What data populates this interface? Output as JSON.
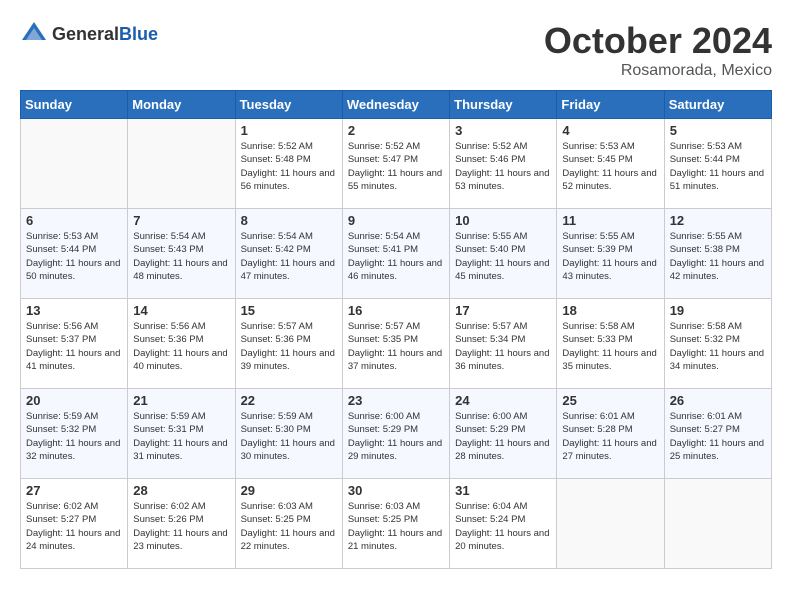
{
  "logo": {
    "general": "General",
    "blue": "Blue"
  },
  "title": {
    "month": "October 2024",
    "location": "Rosamorada, Mexico"
  },
  "headers": [
    "Sunday",
    "Monday",
    "Tuesday",
    "Wednesday",
    "Thursday",
    "Friday",
    "Saturday"
  ],
  "weeks": [
    [
      {
        "day": "",
        "info": ""
      },
      {
        "day": "",
        "info": ""
      },
      {
        "day": "1",
        "info": "Sunrise: 5:52 AM\nSunset: 5:48 PM\nDaylight: 11 hours and 56 minutes."
      },
      {
        "day": "2",
        "info": "Sunrise: 5:52 AM\nSunset: 5:47 PM\nDaylight: 11 hours and 55 minutes."
      },
      {
        "day": "3",
        "info": "Sunrise: 5:52 AM\nSunset: 5:46 PM\nDaylight: 11 hours and 53 minutes."
      },
      {
        "day": "4",
        "info": "Sunrise: 5:53 AM\nSunset: 5:45 PM\nDaylight: 11 hours and 52 minutes."
      },
      {
        "day": "5",
        "info": "Sunrise: 5:53 AM\nSunset: 5:44 PM\nDaylight: 11 hours and 51 minutes."
      }
    ],
    [
      {
        "day": "6",
        "info": "Sunrise: 5:53 AM\nSunset: 5:44 PM\nDaylight: 11 hours and 50 minutes."
      },
      {
        "day": "7",
        "info": "Sunrise: 5:54 AM\nSunset: 5:43 PM\nDaylight: 11 hours and 48 minutes."
      },
      {
        "day": "8",
        "info": "Sunrise: 5:54 AM\nSunset: 5:42 PM\nDaylight: 11 hours and 47 minutes."
      },
      {
        "day": "9",
        "info": "Sunrise: 5:54 AM\nSunset: 5:41 PM\nDaylight: 11 hours and 46 minutes."
      },
      {
        "day": "10",
        "info": "Sunrise: 5:55 AM\nSunset: 5:40 PM\nDaylight: 11 hours and 45 minutes."
      },
      {
        "day": "11",
        "info": "Sunrise: 5:55 AM\nSunset: 5:39 PM\nDaylight: 11 hours and 43 minutes."
      },
      {
        "day": "12",
        "info": "Sunrise: 5:55 AM\nSunset: 5:38 PM\nDaylight: 11 hours and 42 minutes."
      }
    ],
    [
      {
        "day": "13",
        "info": "Sunrise: 5:56 AM\nSunset: 5:37 PM\nDaylight: 11 hours and 41 minutes."
      },
      {
        "day": "14",
        "info": "Sunrise: 5:56 AM\nSunset: 5:36 PM\nDaylight: 11 hours and 40 minutes."
      },
      {
        "day": "15",
        "info": "Sunrise: 5:57 AM\nSunset: 5:36 PM\nDaylight: 11 hours and 39 minutes."
      },
      {
        "day": "16",
        "info": "Sunrise: 5:57 AM\nSunset: 5:35 PM\nDaylight: 11 hours and 37 minutes."
      },
      {
        "day": "17",
        "info": "Sunrise: 5:57 AM\nSunset: 5:34 PM\nDaylight: 11 hours and 36 minutes."
      },
      {
        "day": "18",
        "info": "Sunrise: 5:58 AM\nSunset: 5:33 PM\nDaylight: 11 hours and 35 minutes."
      },
      {
        "day": "19",
        "info": "Sunrise: 5:58 AM\nSunset: 5:32 PM\nDaylight: 11 hours and 34 minutes."
      }
    ],
    [
      {
        "day": "20",
        "info": "Sunrise: 5:59 AM\nSunset: 5:32 PM\nDaylight: 11 hours and 32 minutes."
      },
      {
        "day": "21",
        "info": "Sunrise: 5:59 AM\nSunset: 5:31 PM\nDaylight: 11 hours and 31 minutes."
      },
      {
        "day": "22",
        "info": "Sunrise: 5:59 AM\nSunset: 5:30 PM\nDaylight: 11 hours and 30 minutes."
      },
      {
        "day": "23",
        "info": "Sunrise: 6:00 AM\nSunset: 5:29 PM\nDaylight: 11 hours and 29 minutes."
      },
      {
        "day": "24",
        "info": "Sunrise: 6:00 AM\nSunset: 5:29 PM\nDaylight: 11 hours and 28 minutes."
      },
      {
        "day": "25",
        "info": "Sunrise: 6:01 AM\nSunset: 5:28 PM\nDaylight: 11 hours and 27 minutes."
      },
      {
        "day": "26",
        "info": "Sunrise: 6:01 AM\nSunset: 5:27 PM\nDaylight: 11 hours and 25 minutes."
      }
    ],
    [
      {
        "day": "27",
        "info": "Sunrise: 6:02 AM\nSunset: 5:27 PM\nDaylight: 11 hours and 24 minutes."
      },
      {
        "day": "28",
        "info": "Sunrise: 6:02 AM\nSunset: 5:26 PM\nDaylight: 11 hours and 23 minutes."
      },
      {
        "day": "29",
        "info": "Sunrise: 6:03 AM\nSunset: 5:25 PM\nDaylight: 11 hours and 22 minutes."
      },
      {
        "day": "30",
        "info": "Sunrise: 6:03 AM\nSunset: 5:25 PM\nDaylight: 11 hours and 21 minutes."
      },
      {
        "day": "31",
        "info": "Sunrise: 6:04 AM\nSunset: 5:24 PM\nDaylight: 11 hours and 20 minutes."
      },
      {
        "day": "",
        "info": ""
      },
      {
        "day": "",
        "info": ""
      }
    ]
  ]
}
